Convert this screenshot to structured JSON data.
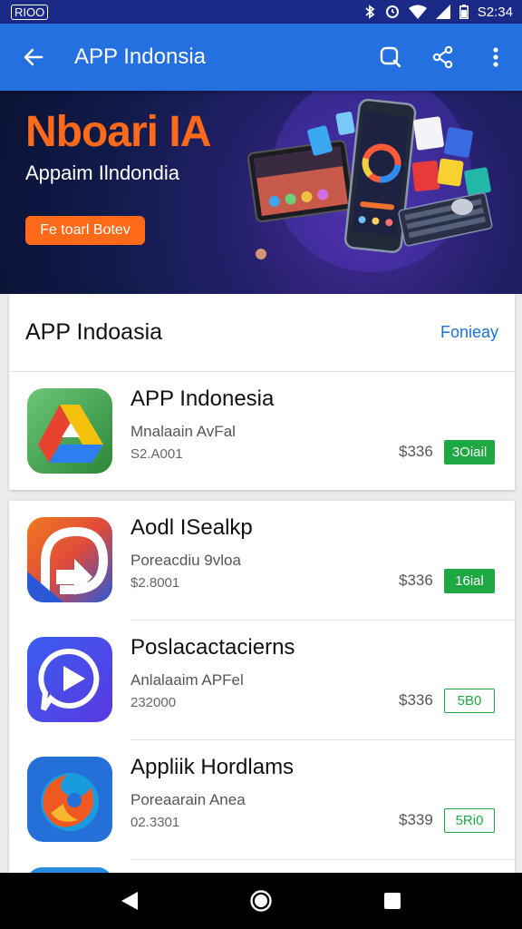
{
  "status_bar": {
    "carrier": "RIOO",
    "time": "S2:34"
  },
  "app_bar": {
    "title": "APP Indonsia",
    "icons": [
      "back-arrow-icon",
      "search-icon",
      "share-icon",
      "more-vert-icon"
    ]
  },
  "banner": {
    "title": "Nboari IA",
    "subtitle": "Appaim Ilndondia",
    "button_label": "Fe toarl Botev"
  },
  "featured_section": {
    "title": "APP Indoasia",
    "link": "Fonieay",
    "app": {
      "name": "APP Indonesia",
      "developer": "Mnalaain AvFal",
      "meta": "S2.A001",
      "price": "$336",
      "button_label": "3Oiail",
      "button_style": "solid"
    }
  },
  "app_list": [
    {
      "name": "Aodl ISealkp",
      "developer": "Poreacdiu 9vloa",
      "meta": "$2.8001",
      "price": "$336",
      "button_label": "16ial",
      "button_style": "solid"
    },
    {
      "name": "Poslacactacierns",
      "developer": "Anlalaaim APFel",
      "meta": "232000",
      "price": "$336",
      "button_label": "5B0",
      "button_style": "outline"
    },
    {
      "name": "Appliik Hordlams",
      "developer": "Poreaarain Anea",
      "meta": "02.3301",
      "price": "$339",
      "button_label": "5Ri0",
      "button_style": "outline"
    }
  ],
  "colors": {
    "status_bar": "#1a2a86",
    "app_bar": "#2470e0",
    "accent_orange": "#ff6a1a",
    "install_green": "#1ea843",
    "link_blue": "#1a74d2"
  },
  "nav_bar": {
    "icons": [
      "nav-back-icon",
      "nav-home-icon",
      "nav-recents-icon"
    ]
  }
}
